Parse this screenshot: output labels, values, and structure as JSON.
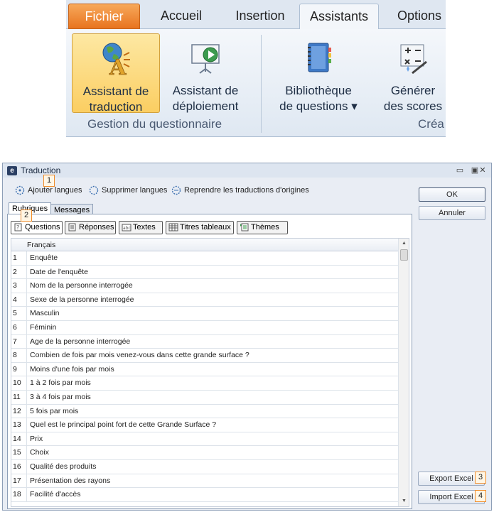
{
  "ribbon": {
    "tabs": [
      "Fichier",
      "Accueil",
      "Insertion",
      "Assistants",
      "Options"
    ],
    "active_tab": "Assistants",
    "buttons": {
      "traduction": [
        "Assistant de",
        "traduction"
      ],
      "deploiement": [
        "Assistant de",
        "déploiement"
      ],
      "bibliotheque": [
        "Bibliothèque",
        "de questions ▾"
      ],
      "scores": [
        "Générer",
        "des scores"
      ]
    },
    "groups": {
      "gestion": "Gestion du questionnaire",
      "crea": "Créa"
    }
  },
  "dialog": {
    "title": "Traduction",
    "toolbar": {
      "ajouter": "Ajouter langues",
      "supprimer": "Supprimer langues",
      "reprendre": "Reprendre les traductions d'origines"
    },
    "tabs": [
      "Rubriques",
      "Messages"
    ],
    "subtabs": [
      "Questions",
      "Réponses",
      "Textes",
      "Titres tableaux",
      "Thèmes"
    ],
    "grid": {
      "header": "Français",
      "rows": [
        {
          "num": "1",
          "text": "Enquête"
        },
        {
          "num": "2",
          "text": "Date de l'enquête"
        },
        {
          "num": "3",
          "text": "Nom de la personne interrogée"
        },
        {
          "num": "4",
          "text": "Sexe de la personne interrogée"
        },
        {
          "num": "5",
          "text": "Masculin"
        },
        {
          "num": "6",
          "text": "Féminin"
        },
        {
          "num": "7",
          "text": "Age de la personne interrogée"
        },
        {
          "num": "8",
          "text": "Combien de fois par mois venez-vous dans cette grande surface ?"
        },
        {
          "num": "9",
          "text": "Moins d'une fois par mois"
        },
        {
          "num": "10",
          "text": "1 à 2 fois par mois"
        },
        {
          "num": "11",
          "text": "3 à 4 fois par mois"
        },
        {
          "num": "12",
          "text": "5 fois par mois"
        },
        {
          "num": "13",
          "text": "Quel est le principal point fort de cette Grande Surface ?"
        },
        {
          "num": "14",
          "text": "Prix"
        },
        {
          "num": "15",
          "text": "Choix"
        },
        {
          "num": "16",
          "text": "Qualité des produits"
        },
        {
          "num": "17",
          "text": "Présentation des rayons"
        },
        {
          "num": "18",
          "text": "Facilité d'accès"
        }
      ]
    },
    "buttons": {
      "ok": "OK",
      "annuler": "Annuler",
      "export": "Export Excel",
      "import": "Import Excel"
    },
    "callouts": [
      "1",
      "2",
      "3",
      "4"
    ]
  },
  "colors": {
    "fichier_tab": "#e8741f",
    "selected_button": "#fbce62",
    "callout_border": "#f08e2c",
    "dialog_bg": "#e9edf4"
  }
}
